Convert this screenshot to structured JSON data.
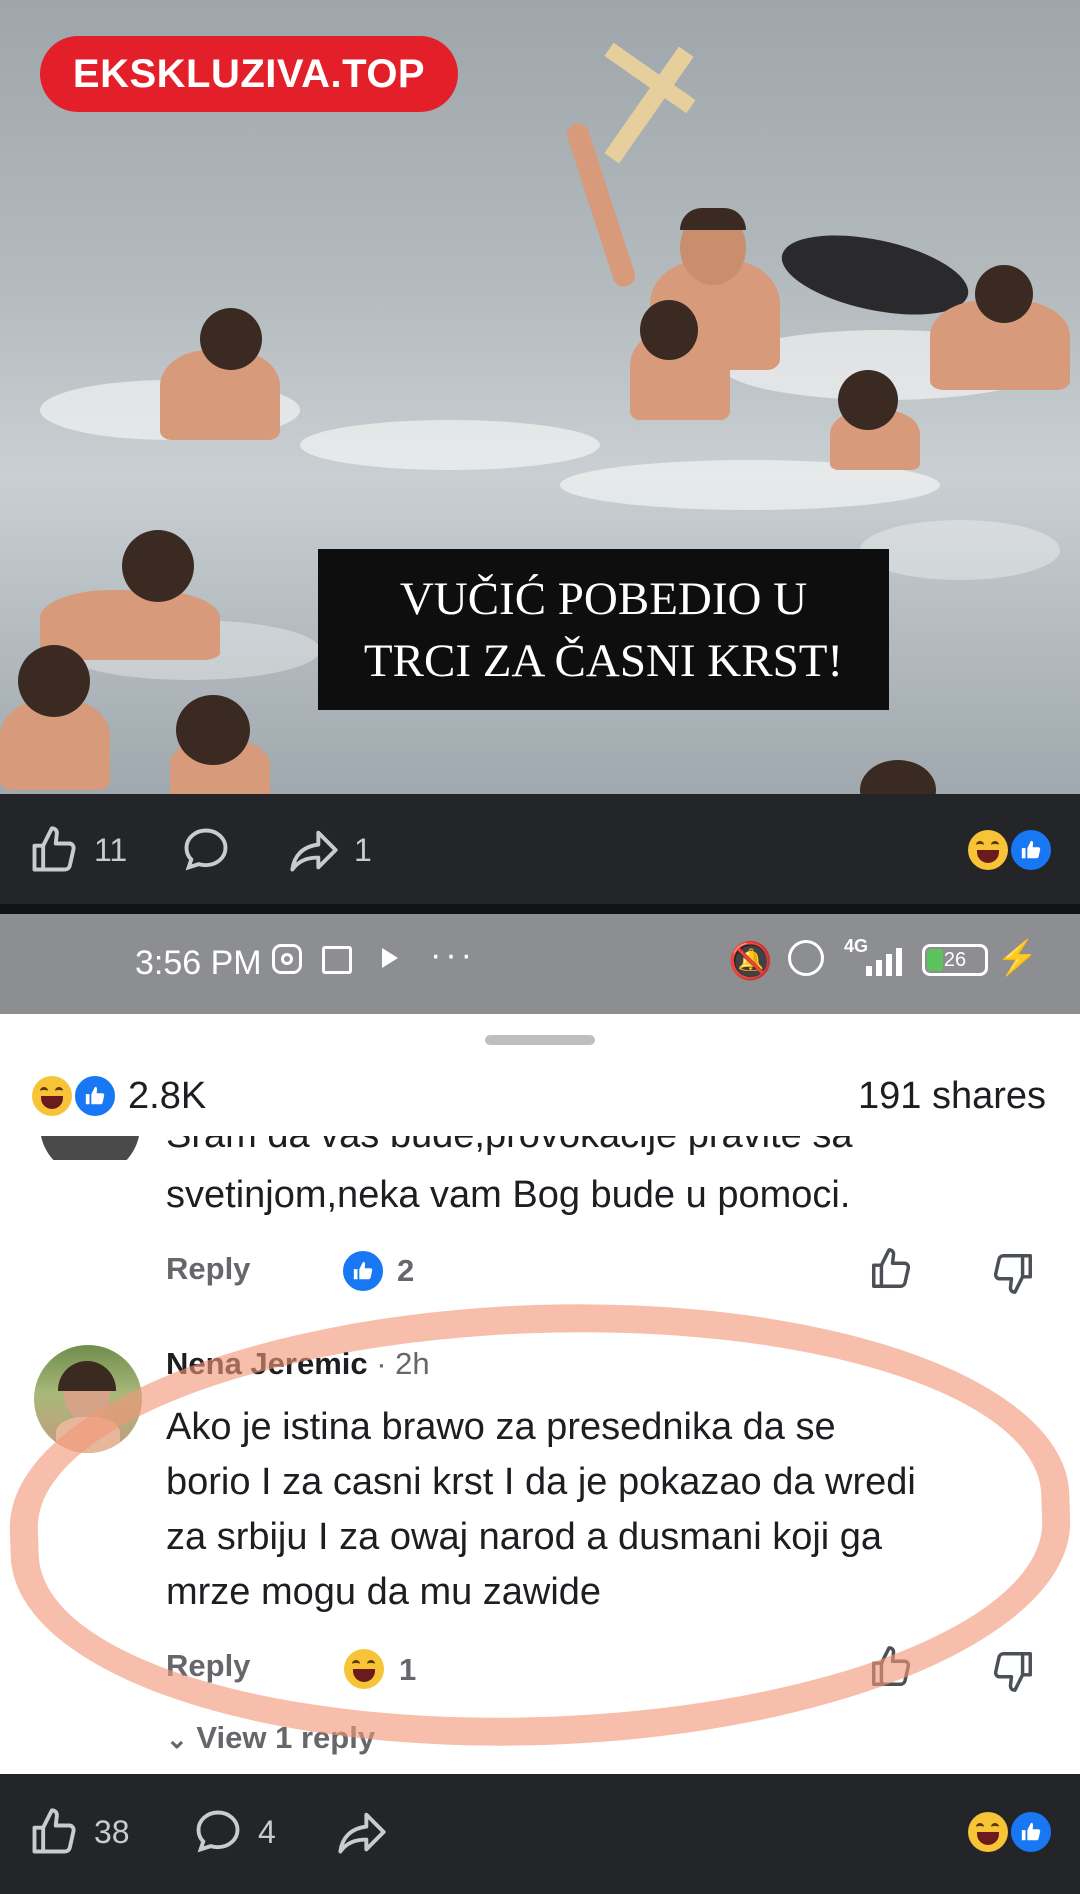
{
  "photo": {
    "brand": "EKSKLUZIVA.TOP",
    "caption_line1": "VUČIĆ POBEDIO U",
    "caption_line2": "TRCI ZA ČASNI KRST!"
  },
  "top_actionbar": {
    "like_count": "11",
    "comment_count": "",
    "share_count": "1"
  },
  "status_bar": {
    "time": "3:56 PM",
    "network": "4G",
    "battery": "26"
  },
  "post_summary": {
    "reaction_count": "2.8K",
    "shares": "191 shares"
  },
  "comments": [
    {
      "text_line1": "Sram da vas bude,provokacije pravite sa",
      "text_line2": "svetinjom,neka vam Bog bude u pomoci.",
      "reply_label": "Reply",
      "reaction_count": "2"
    },
    {
      "author": "Nena Jeremic",
      "time": "· 2h",
      "lines": [
        "Ako je istina brawo za presednika da se",
        "borio I za casni krst I da je pokazao da wredi",
        "za srbiju I za owaj narod a dusmani koji ga",
        "mrze mogu da mu zawide"
      ],
      "reply_label": "Reply",
      "reaction_count": "1",
      "view_replies": "View 1 reply"
    }
  ],
  "bottom_actionbar": {
    "like_count": "38",
    "comment_count": "4"
  },
  "colors": {
    "brand_red": "#e3202a",
    "facebook_blue": "#1877f2",
    "annotation": "#f29678"
  }
}
